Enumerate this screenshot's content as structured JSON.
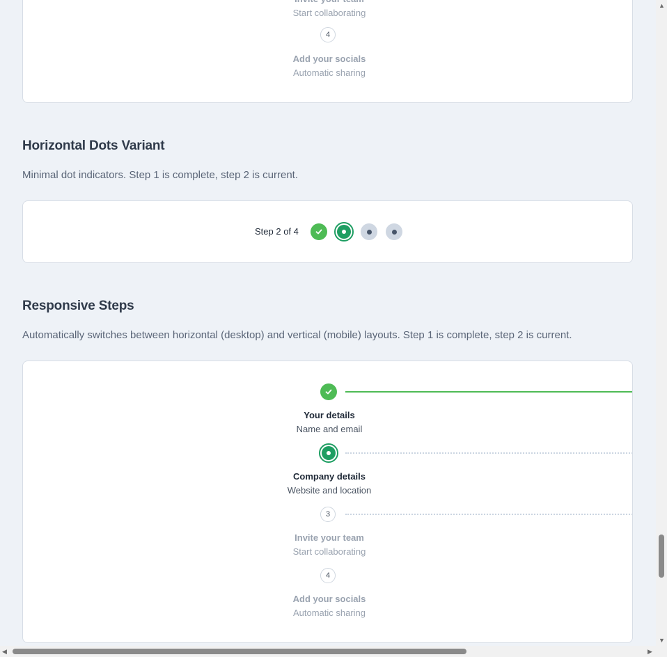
{
  "top_card": {
    "steps": [
      {
        "label": "Invite your team",
        "sub": "Start collaborating"
      },
      {
        "number": "4",
        "label": "Add your socials",
        "sub": "Automatic sharing"
      }
    ]
  },
  "dots_section": {
    "title": "Horizontal Dots Variant",
    "description": "Minimal dot indicators. Step 1 is complete, step 2 is current.",
    "indicator_text": "Step 2 of 4",
    "total_steps": 4,
    "completed_steps": 1,
    "current_step": 2
  },
  "responsive_section": {
    "title": "Responsive Steps",
    "description": "Automatically switches between horizontal (desktop) and vertical (mobile) layouts. Step 1 is complete, step 2 is current.",
    "steps": [
      {
        "state": "complete",
        "label": "Your details",
        "sub": "Name and email"
      },
      {
        "state": "current",
        "label": "Company details",
        "sub": "Website and location"
      },
      {
        "state": "pending",
        "number": "3",
        "label": "Invite your team",
        "sub": "Start collaborating"
      },
      {
        "state": "pending",
        "number": "4",
        "label": "Add your socials",
        "sub": "Automatic sharing"
      }
    ]
  },
  "colors": {
    "complete": "#4ebb55",
    "current": "#1e9e62",
    "pending": "#cfd7e2"
  }
}
